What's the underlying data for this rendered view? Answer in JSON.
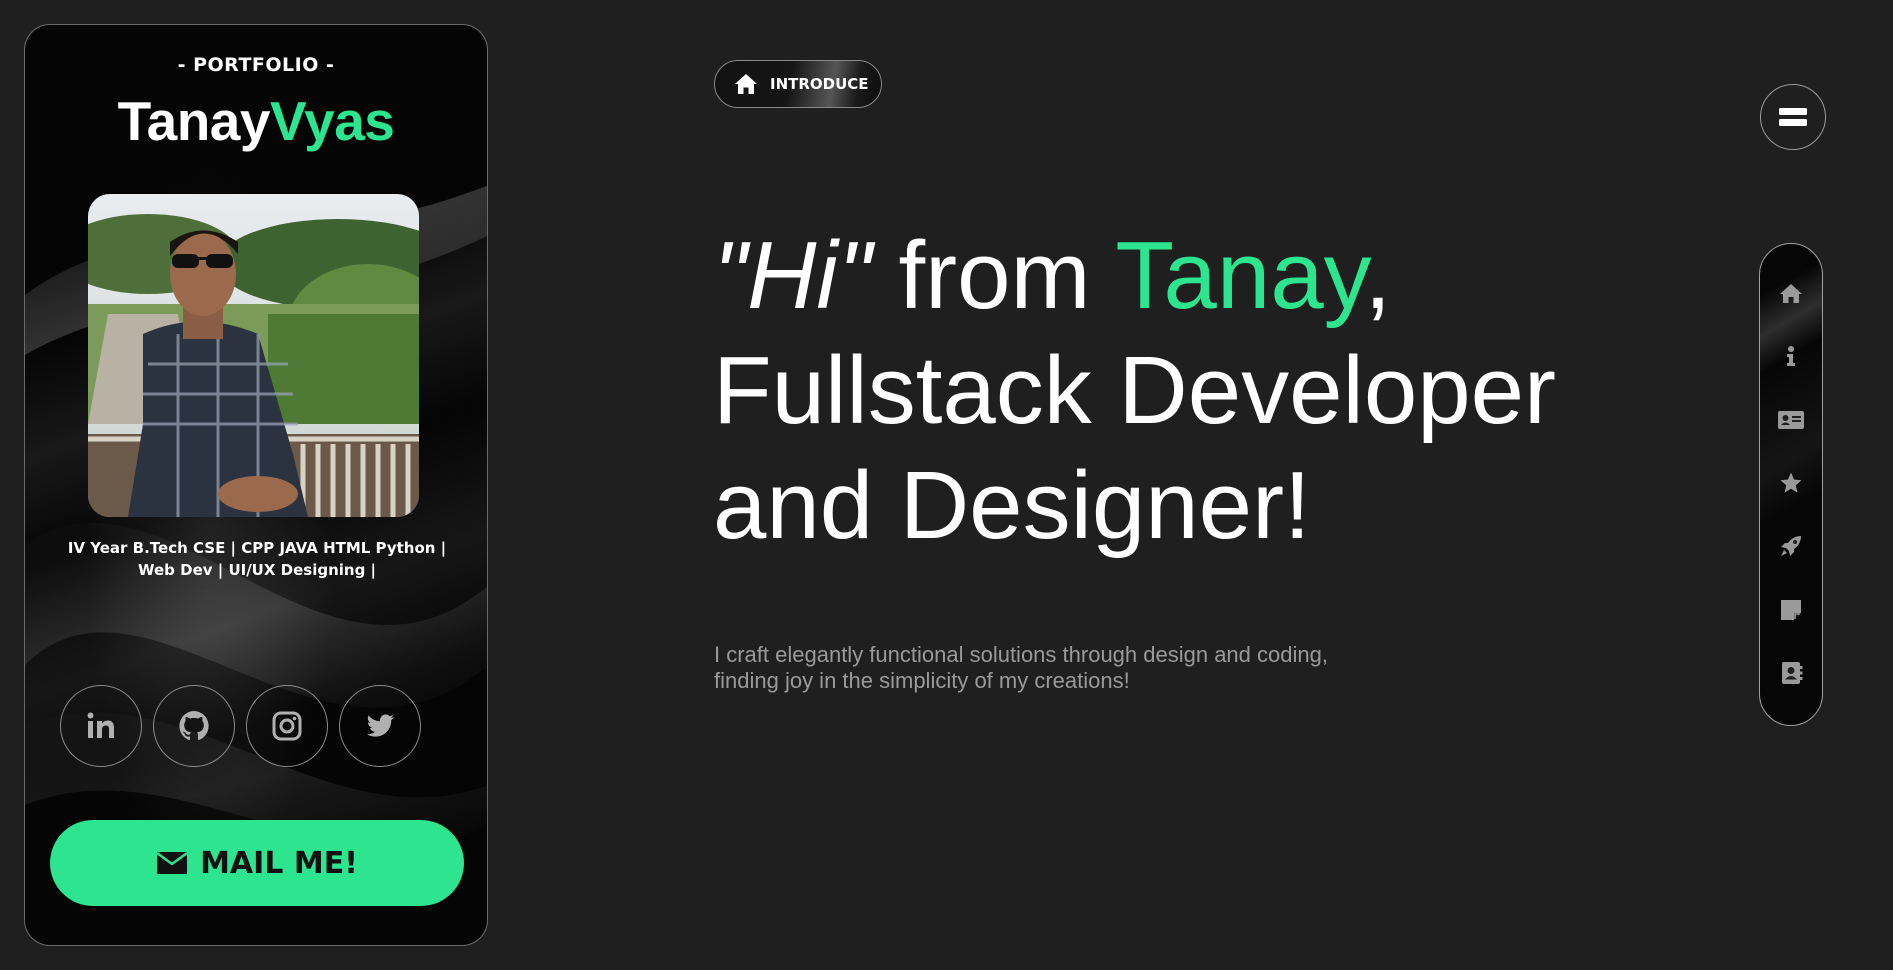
{
  "card": {
    "portfolio_label": "- PORTFOLIO -",
    "name_first": "Tanay",
    "name_last": "Vyas",
    "bio_line1": "IV Year B.Tech CSE | CPP JAVA HTML Python |",
    "bio_line2": "Web Dev | UI/UX Designing |",
    "socials": [
      {
        "icon": "linkedin-icon"
      },
      {
        "icon": "github-icon"
      },
      {
        "icon": "instagram-icon"
      },
      {
        "icon": "twitter-icon"
      }
    ],
    "mail_label": "MAIL ME!"
  },
  "main": {
    "badge_label": "INTRODUCE",
    "headline_hi": "\"Hi\"",
    "headline_from": " from ",
    "headline_name": "Tanay",
    "headline_comma": ",",
    "headline_line2": "Fullstack Developer",
    "headline_line3": "and Designer!",
    "tagline_line1": "I craft elegantly functional solutions through design and coding,",
    "tagline_line2": "finding joy in the simplicity of my creations!"
  },
  "side_nav": {
    "items": [
      "home-icon",
      "info-icon",
      "id-card-icon",
      "star-icon",
      "rocket-icon",
      "note-icon",
      "contact-book-icon"
    ]
  },
  "colors": {
    "accent": "#2ee58f",
    "background": "#1f1f1f",
    "card_background": "#050505",
    "muted_text": "#9a9a9a"
  }
}
